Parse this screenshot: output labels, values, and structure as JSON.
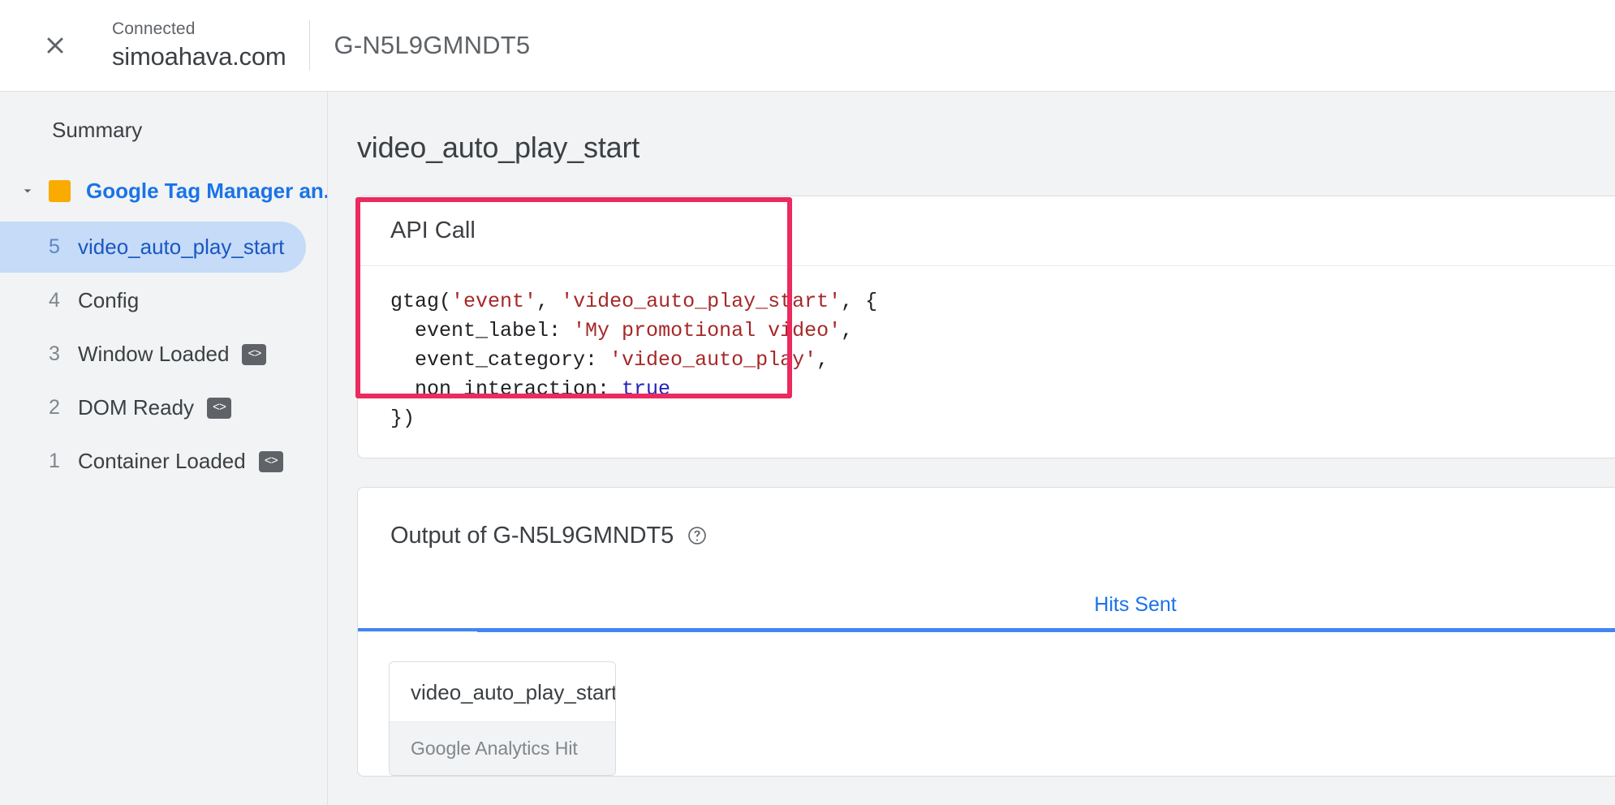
{
  "header": {
    "close_icon": "close-icon",
    "connected_label": "Connected",
    "domain": "simoahava.com",
    "measurement_id": "G-N5L9GMNDT5"
  },
  "sidebar": {
    "summary_label": "Summary",
    "group": {
      "icon": "gtm-square-icon",
      "caret": "chevron-down-icon",
      "label": "Google Tag Manager an...",
      "color": "#f9ab00"
    },
    "events": [
      {
        "num": "5",
        "label": "video_auto_play_start",
        "selected": true,
        "has_code_badge": false
      },
      {
        "num": "4",
        "label": "Config",
        "selected": false,
        "has_code_badge": false
      },
      {
        "num": "3",
        "label": "Window Loaded",
        "selected": false,
        "has_code_badge": true
      },
      {
        "num": "2",
        "label": "DOM Ready",
        "selected": false,
        "has_code_badge": true
      },
      {
        "num": "1",
        "label": "Container Loaded",
        "selected": false,
        "has_code_badge": true
      }
    ],
    "code_badge_glyph": "<>"
  },
  "main": {
    "page_title": "video_auto_play_start",
    "api_call": {
      "card_title": "API Call",
      "highlight_color": "#eb2a5f",
      "code_lines": [
        [
          {
            "t": "gtag(",
            "c": "plain"
          },
          {
            "t": "'event'",
            "c": "str"
          },
          {
            "t": ", ",
            "c": "plain"
          },
          {
            "t": "'video_auto_play_start'",
            "c": "str"
          },
          {
            "t": ", {",
            "c": "plain"
          }
        ],
        [
          {
            "t": "  event_label: ",
            "c": "plain"
          },
          {
            "t": "'My promotional video'",
            "c": "str"
          },
          {
            "t": ",",
            "c": "plain"
          }
        ],
        [
          {
            "t": "  event_category: ",
            "c": "plain"
          },
          {
            "t": "'video_auto_play'",
            "c": "str"
          },
          {
            "t": ",",
            "c": "plain"
          }
        ],
        [
          {
            "t": "  non_interaction: ",
            "c": "plain"
          },
          {
            "t": "true",
            "c": "kw"
          }
        ],
        [
          {
            "t": "})",
            "c": "plain"
          }
        ]
      ]
    },
    "output": {
      "title": "Output of G-N5L9GMNDT5",
      "help_icon": "help-circle-icon",
      "tabs": [
        {
          "label": "Hits Sent",
          "active": true
        }
      ],
      "hits": [
        {
          "title": "video_auto_play_start",
          "subtitle": "Google Analytics Hit"
        }
      ]
    }
  }
}
